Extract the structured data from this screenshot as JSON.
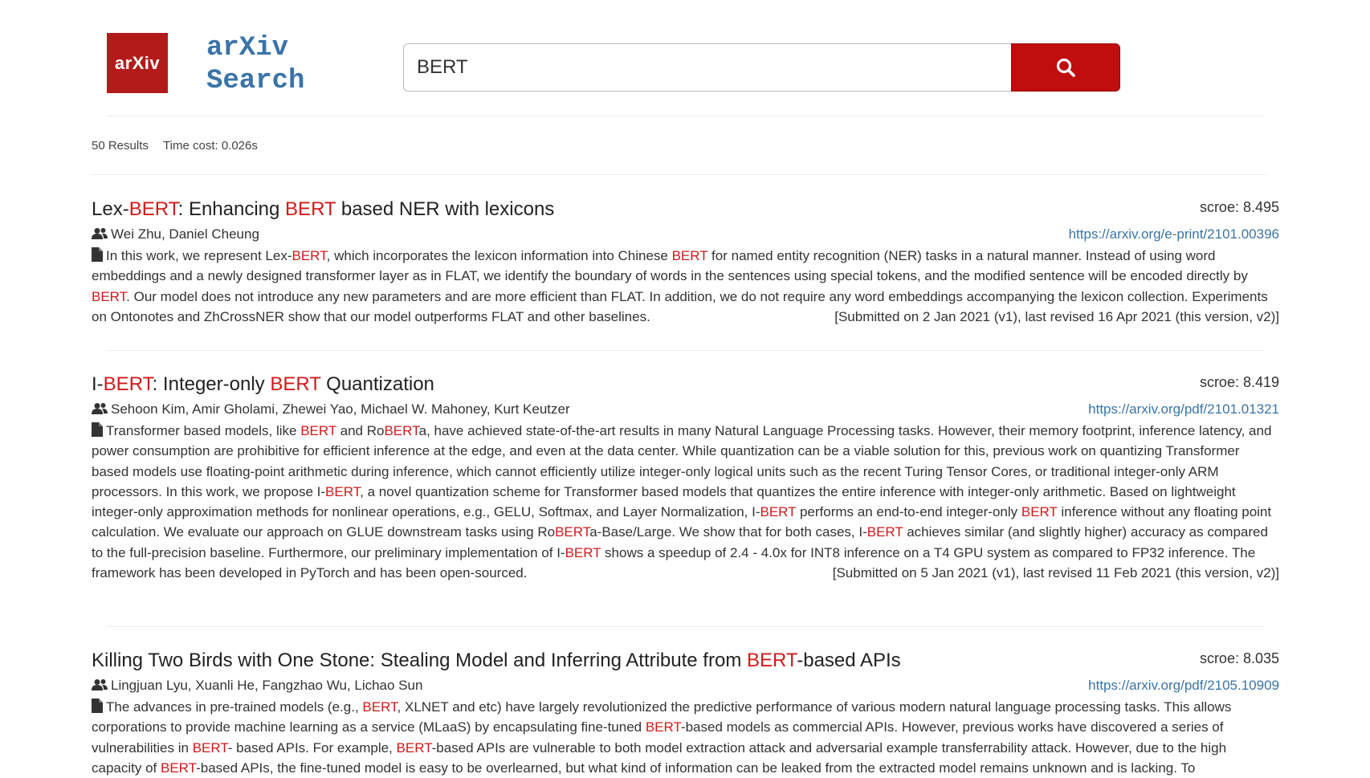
{
  "header": {
    "logo_text": "arXiv",
    "site_title": "arXiv\nSearch",
    "search": {
      "value": "BERT",
      "placeholder": ""
    }
  },
  "meta": {
    "results": "50 Results",
    "time_cost": "Time cost: 0.026s"
  },
  "results": [
    {
      "title": [
        "Lex-",
        "BERT",
        ": Enhancing ",
        "BERT",
        " based NER with lexicons"
      ],
      "score": "scroe: 8.495",
      "link": "https://arxiv.org/e-print/2101.00396",
      "authors": "Wei Zhu, Daniel Cheung",
      "abstract": [
        "In this work, we represent Lex-",
        "BERT",
        ", which incorporates the lexicon information into Chinese ",
        "BERT",
        " for named entity recognition (NER) tasks in a natural manner. Instead of using word embeddings and a newly designed transformer layer as in FLAT, we identify the boundary of words in the sentences using special tokens, and the modified sentence will be encoded directly by ",
        "BERT",
        ". Our model does not introduce any new parameters and are more efficient than FLAT. In addition, we do not require any word embeddings accompanying the lexicon collection. Experiments on Ontonotes and ZhCrossNER show that our model outperforms FLAT and other baselines."
      ],
      "submitted": "[Submitted on 2 Jan 2021 (v1), last revised 16 Apr 2021 (this version, v2)]"
    },
    {
      "title": [
        "I-",
        "BERT",
        ": Integer-only ",
        "BERT",
        " Quantization"
      ],
      "score": "scroe: 8.419",
      "link": "https://arxiv.org/pdf/2101.01321",
      "authors": "Sehoon Kim, Amir Gholami, Zhewei Yao, Michael W. Mahoney, Kurt Keutzer",
      "abstract": [
        "Transformer based models, like ",
        "BERT",
        " and Ro",
        "BERT",
        "a, have achieved state-of-the-art results in many Natural Language Processing tasks. However, their memory footprint, inference latency, and power consumption are prohibitive for efficient inference at the edge, and even at the data center. While quantization can be a viable solution for this, previous work on quantizing Transformer based models use floating-point arithmetic during inference, which cannot efficiently utilize integer-only logical units such as the recent Turing Tensor Cores, or traditional integer-only ARM processors. In this work, we propose I-",
        "BERT",
        ", a novel quantization scheme for Transformer based models that quantizes the entire inference with integer-only arithmetic. Based on lightweight integer-only approximation methods for nonlinear operations, e.g., GELU, Softmax, and Layer Normalization, I-",
        "BERT",
        " performs an end-to-end integer-only ",
        "BERT",
        " inference without any floating point calculation. We evaluate our approach on GLUE downstream tasks using Ro",
        "BERT",
        "a-Base/Large. We show that for both cases, I-",
        "BERT",
        " achieves similar (and slightly higher) accuracy as compared to the full-precision baseline. Furthermore, our preliminary implementation of I-",
        "BERT",
        " shows a speedup of 2.4 - 4.0x for INT8 inference on a T4 GPU system as compared to FP32 inference. The framework has been developed in PyTorch and has been open-sourced."
      ],
      "submitted": "[Submitted on 5 Jan 2021 (v1), last revised 11 Feb 2021 (this version, v2)]"
    },
    {
      "title": [
        "Killing Two Birds with One Stone: Stealing Model and Inferring Attribute from ",
        "BERT",
        "-based APIs"
      ],
      "score": "scroe: 8.035",
      "link": "https://arxiv.org/pdf/2105.10909",
      "authors": "Lingjuan Lyu, Xuanli He, Fangzhao Wu, Lichao Sun",
      "abstract": [
        "The advances in pre-trained models (e.g., ",
        "BERT",
        ", XLNET and etc) have largely revolutionized the predictive performance of various modern natural language processing tasks. This allows corporations to provide machine learning as a service (MLaaS) by encapsulating fine-tuned ",
        "BERT",
        "-based models as commercial APIs. However, previous works have discovered a series of vulnerabilities in ",
        "BERT",
        "- based APIs. For example, ",
        "BERT",
        "-based APIs are vulnerable to both model extraction attack and adversarial example transferrability attack. However, due to the high capacity of ",
        "BERT",
        "-based APIs, the fine-tuned model is easy to be overlearned, but what kind of information can be leaked from the extracted model remains unknown and is lacking. To"
      ],
      "submitted": ""
    }
  ],
  "colors": {
    "brand_red": "#b31b1b",
    "button_red": "#c00d0d",
    "link_blue": "#3a74a8",
    "highlight_red": "#d11a1a"
  },
  "icons": {
    "search": "search-icon",
    "authors": "users-icon",
    "abstract": "file-icon"
  }
}
